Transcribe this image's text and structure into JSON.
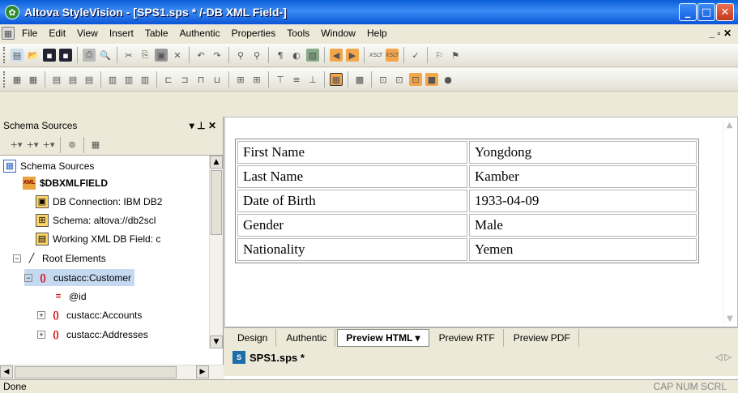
{
  "window": {
    "title": "Altova StyleVision - [SPS1.sps * /-DB XML Field-]"
  },
  "menu": [
    "File",
    "Edit",
    "View",
    "Insert",
    "Table",
    "Authentic",
    "Properties",
    "Tools",
    "Window",
    "Help"
  ],
  "schema_pane": {
    "title": "Schema Sources",
    "pin": "▾ ⊥ ✕",
    "tree": [
      {
        "label": "Schema Sources",
        "icon": "schema-sources-icon"
      },
      {
        "label": "$DBXMLFIELD",
        "icon": "db-xml-icon"
      },
      {
        "label": "DB Connection: IBM DB2",
        "icon": "db-connection-icon"
      },
      {
        "label": "Schema: altova://db2scl",
        "icon": "schema-icon"
      },
      {
        "label": "Working XML DB Field: c",
        "icon": "working-xml-icon"
      },
      {
        "label": "Root Elements",
        "icon": "root-elements-icon"
      },
      {
        "label": "custacc:Customer",
        "icon": "element-icon"
      },
      {
        "label": "@id",
        "icon": "attribute-icon"
      },
      {
        "label": "custacc:Accounts",
        "icon": "element-icon"
      },
      {
        "label": "custacc:Addresses",
        "icon": "element-icon"
      }
    ]
  },
  "record": [
    {
      "label": "First Name",
      "value": "Yongdong"
    },
    {
      "label": "Last Name",
      "value": "Kamber"
    },
    {
      "label": "Date of Birth",
      "value": "1933-04-09"
    },
    {
      "label": "Gender",
      "value": "Male"
    },
    {
      "label": "Nationality",
      "value": "Yemen"
    }
  ],
  "view_tabs": [
    "Design",
    "Authentic",
    "Preview HTML ▾",
    "Preview RTF",
    "Preview PDF"
  ],
  "active_view": "Preview HTML",
  "file_tab": "SPS1.sps *",
  "status": {
    "left": "Done",
    "right": "CAP  NUM  SCRL"
  }
}
